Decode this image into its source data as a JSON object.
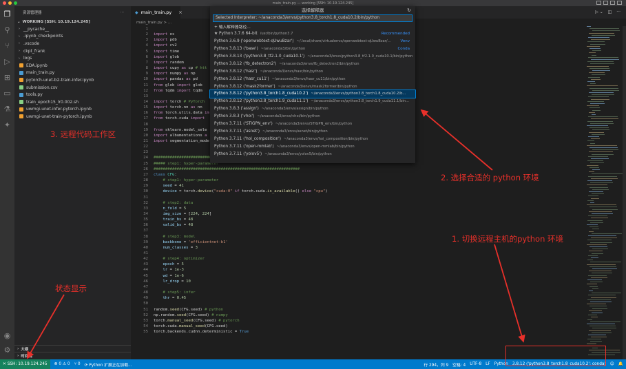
{
  "window": {
    "title": "main_train.py — working [SSH: 10.19.124.245]"
  },
  "explorer": {
    "title": "资源管理器",
    "more": "···",
    "workspace": "WORKING [SSH: 10.19.124.245]",
    "items": [
      {
        "name": "__pycache__",
        "type": "folder",
        "color": ""
      },
      {
        "name": ".ipynb_checkpoints",
        "type": "folder",
        "color": ""
      },
      {
        "name": ".vscode",
        "type": "folder",
        "color": ""
      },
      {
        "name": "ckpt_frank",
        "type": "folder",
        "color": ""
      },
      {
        "name": "logs",
        "type": "folder",
        "color": ""
      },
      {
        "name": "EDA.ipynb",
        "type": "file",
        "color": "#f0a030"
      },
      {
        "name": "main_train.py",
        "type": "file",
        "color": "#4b9cd3"
      },
      {
        "name": "pytorch-unet-b2-train-infer.ipynb",
        "type": "file",
        "color": "#f0a030"
      },
      {
        "name": "submission.csv",
        "type": "file",
        "color": "#89d185"
      },
      {
        "name": "tools.py",
        "type": "file",
        "color": "#4b9cd3"
      },
      {
        "name": "train_epoch15_lr0.002.sh",
        "type": "file",
        "color": "#89d185"
      },
      {
        "name": "uwmgi-unet-infer-pytorch.ipynb",
        "type": "file",
        "color": "#f0a030"
      },
      {
        "name": "uwmgi-unet-train-pytorch.ipynb",
        "type": "file",
        "color": "#f0a030"
      }
    ],
    "outline": "大纲",
    "timeline": "时间线"
  },
  "tab": {
    "label": "main_train.py",
    "close": "×"
  },
  "breadcrumb": "main_train.py > ...",
  "code_lines": [
    [
      {
        "t": "",
        "c": "code"
      }
    ],
    [
      {
        "t": "import",
        "c": "kw"
      },
      {
        "t": " os",
        "c": "code"
      }
    ],
    [
      {
        "t": "import",
        "c": "kw"
      },
      {
        "t": " pdb",
        "c": "code"
      }
    ],
    [
      {
        "t": "import",
        "c": "kw"
      },
      {
        "t": " cv2",
        "c": "code"
      }
    ],
    [
      {
        "t": "import",
        "c": "kw"
      },
      {
        "t": " time",
        "c": "code"
      }
    ],
    [
      {
        "t": "import",
        "c": "kw"
      },
      {
        "t": " glob",
        "c": "code"
      }
    ],
    [
      {
        "t": "import",
        "c": "kw"
      },
      {
        "t": " random",
        "c": "code"
      }
    ],
    [
      {
        "t": "import",
        "c": "kw"
      },
      {
        "t": " cupy ",
        "c": "code"
      },
      {
        "t": "as",
        "c": "kw"
      },
      {
        "t": " cp ",
        "c": "code"
      },
      {
        "t": "# htt",
        "c": "cm"
      }
    ],
    [
      {
        "t": "import",
        "c": "kw"
      },
      {
        "t": " numpy ",
        "c": "code"
      },
      {
        "t": "as",
        "c": "kw"
      },
      {
        "t": " np",
        "c": "code"
      }
    ],
    [
      {
        "t": "import",
        "c": "kw"
      },
      {
        "t": " pandas ",
        "c": "code"
      },
      {
        "t": "as",
        "c": "kw"
      },
      {
        "t": " pd",
        "c": "code"
      }
    ],
    [
      {
        "t": "from",
        "c": "kw"
      },
      {
        "t": " glob ",
        "c": "code"
      },
      {
        "t": "import",
        "c": "kw"
      },
      {
        "t": " glob",
        "c": "code"
      }
    ],
    [
      {
        "t": "from",
        "c": "kw"
      },
      {
        "t": " tqdm ",
        "c": "code"
      },
      {
        "t": "import",
        "c": "kw"
      },
      {
        "t": " tqdm",
        "c": "code"
      }
    ],
    [
      {
        "t": "",
        "c": "code"
      }
    ],
    [
      {
        "t": "import",
        "c": "kw"
      },
      {
        "t": " torch ",
        "c": "code"
      },
      {
        "t": "# PyTorch",
        "c": "cm"
      }
    ],
    [
      {
        "t": "import",
        "c": "kw"
      },
      {
        "t": " torch.nn ",
        "c": "code"
      },
      {
        "t": "as",
        "c": "kw"
      },
      {
        "t": " nn",
        "c": "code"
      }
    ],
    [
      {
        "t": "from",
        "c": "kw"
      },
      {
        "t": " torch.utils.data ",
        "c": "code"
      },
      {
        "t": "im",
        "c": "kw"
      }
    ],
    [
      {
        "t": "from",
        "c": "kw"
      },
      {
        "t": " torch.cuda ",
        "c": "code"
      },
      {
        "t": "import",
        "c": "kw"
      }
    ],
    [
      {
        "t": "",
        "c": "code"
      }
    ],
    [
      {
        "t": "from",
        "c": "kw"
      },
      {
        "t": " sklearn.model_sele",
        "c": "code"
      }
    ],
    [
      {
        "t": "import",
        "c": "kw"
      },
      {
        "t": " albumentations ",
        "c": "code"
      },
      {
        "t": "a",
        "c": "kw"
      }
    ],
    [
      {
        "t": "import",
        "c": "kw"
      },
      {
        "t": " segmentation_mode",
        "c": "code"
      }
    ],
    [
      {
        "t": "",
        "c": "code"
      }
    ],
    [
      {
        "t": "",
        "c": "code"
      }
    ],
    [
      {
        "t": "###############################################################",
        "c": "cm"
      }
    ],
    [
      {
        "t": "##### step1: hyper-parameter",
        "c": "cm"
      }
    ],
    [
      {
        "t": "###############################################################",
        "c": "cm"
      }
    ],
    [
      {
        "t": "class",
        "c": "kwb"
      },
      {
        "t": " ",
        "c": "code"
      },
      {
        "t": "CFG",
        "c": "cls"
      },
      {
        "t": ":",
        "c": "code"
      }
    ],
    [
      {
        "t": "    # step1: hyper-parameter",
        "c": "cm"
      }
    ],
    [
      {
        "t": "    ",
        "c": "code"
      },
      {
        "t": "seed",
        "c": "var"
      },
      {
        "t": " = ",
        "c": "code"
      },
      {
        "t": "41",
        "c": "num"
      }
    ],
    [
      {
        "t": "    ",
        "c": "code"
      },
      {
        "t": "device",
        "c": "var"
      },
      {
        "t": " = torch.",
        "c": "code"
      },
      {
        "t": "device",
        "c": "fn"
      },
      {
        "t": "(",
        "c": "code"
      },
      {
        "t": "\"cuda:0\"",
        "c": "str"
      },
      {
        "t": " ",
        "c": "code"
      },
      {
        "t": "if",
        "c": "kw"
      },
      {
        "t": " torch.cuda.",
        "c": "code"
      },
      {
        "t": "is_available",
        "c": "fn"
      },
      {
        "t": "() ",
        "c": "code"
      },
      {
        "t": "else",
        "c": "kw"
      },
      {
        "t": " ",
        "c": "code"
      },
      {
        "t": "\"cpu\"",
        "c": "str"
      },
      {
        "t": ")",
        "c": "code"
      }
    ],
    [
      {
        "t": "",
        "c": "code"
      }
    ],
    [
      {
        "t": "    # step2: data",
        "c": "cm"
      }
    ],
    [
      {
        "t": "    ",
        "c": "code"
      },
      {
        "t": "n_fold",
        "c": "var"
      },
      {
        "t": " = ",
        "c": "code"
      },
      {
        "t": "5",
        "c": "num"
      }
    ],
    [
      {
        "t": "    ",
        "c": "code"
      },
      {
        "t": "img_size",
        "c": "var"
      },
      {
        "t": " = [",
        "c": "code"
      },
      {
        "t": "224",
        "c": "num"
      },
      {
        "t": ", ",
        "c": "code"
      },
      {
        "t": "224",
        "c": "num"
      },
      {
        "t": "]",
        "c": "code"
      }
    ],
    [
      {
        "t": "    ",
        "c": "code"
      },
      {
        "t": "train_bs",
        "c": "var"
      },
      {
        "t": " = ",
        "c": "code"
      },
      {
        "t": "48",
        "c": "num"
      }
    ],
    [
      {
        "t": "    ",
        "c": "code"
      },
      {
        "t": "valid_bs",
        "c": "var"
      },
      {
        "t": " = ",
        "c": "code"
      },
      {
        "t": "48",
        "c": "num"
      }
    ],
    [
      {
        "t": "",
        "c": "code"
      }
    ],
    [
      {
        "t": "    # step3: model",
        "c": "cm"
      }
    ],
    [
      {
        "t": "    ",
        "c": "code"
      },
      {
        "t": "backbone",
        "c": "var"
      },
      {
        "t": " = ",
        "c": "code"
      },
      {
        "t": "'efficientnet-b1'",
        "c": "str"
      }
    ],
    [
      {
        "t": "    ",
        "c": "code"
      },
      {
        "t": "num_classes",
        "c": "var"
      },
      {
        "t": " = ",
        "c": "code"
      },
      {
        "t": "3",
        "c": "num"
      }
    ],
    [
      {
        "t": "",
        "c": "code"
      }
    ],
    [
      {
        "t": "    # step4: optimizer",
        "c": "cm"
      }
    ],
    [
      {
        "t": "    ",
        "c": "code"
      },
      {
        "t": "epoch",
        "c": "var"
      },
      {
        "t": " = ",
        "c": "code"
      },
      {
        "t": "5",
        "c": "num"
      }
    ],
    [
      {
        "t": "    ",
        "c": "code"
      },
      {
        "t": "lr",
        "c": "var"
      },
      {
        "t": " = ",
        "c": "code"
      },
      {
        "t": "1e-3",
        "c": "num"
      }
    ],
    [
      {
        "t": "    ",
        "c": "code"
      },
      {
        "t": "wd",
        "c": "var"
      },
      {
        "t": " = ",
        "c": "code"
      },
      {
        "t": "1e-6",
        "c": "num"
      }
    ],
    [
      {
        "t": "    ",
        "c": "code"
      },
      {
        "t": "lr_drop",
        "c": "var"
      },
      {
        "t": " = ",
        "c": "code"
      },
      {
        "t": "10",
        "c": "num"
      }
    ],
    [
      {
        "t": "",
        "c": "code"
      }
    ],
    [
      {
        "t": "    # step5: infer",
        "c": "cm"
      }
    ],
    [
      {
        "t": "    ",
        "c": "code"
      },
      {
        "t": "thr",
        "c": "var"
      },
      {
        "t": " = ",
        "c": "code"
      },
      {
        "t": "0.45",
        "c": "num"
      }
    ],
    [
      {
        "t": "",
        "c": "code"
      }
    ],
    [
      {
        "t": "random.",
        "c": "code"
      },
      {
        "t": "seed",
        "c": "fn"
      },
      {
        "t": "(CFG.seed) ",
        "c": "code"
      },
      {
        "t": "# python",
        "c": "cm"
      }
    ],
    [
      {
        "t": "np.random.",
        "c": "code"
      },
      {
        "t": "seed",
        "c": "fn"
      },
      {
        "t": "(CFG.seed) ",
        "c": "code"
      },
      {
        "t": "# numpy",
        "c": "cm"
      }
    ],
    [
      {
        "t": "torch.",
        "c": "code"
      },
      {
        "t": "manual_seed",
        "c": "fn"
      },
      {
        "t": "(CFG.seed) ",
        "c": "code"
      },
      {
        "t": "# pytorch",
        "c": "cm"
      }
    ],
    [
      {
        "t": "torch.cuda.",
        "c": "code"
      },
      {
        "t": "manual_seed",
        "c": "fn"
      },
      {
        "t": "(CFG.seed)",
        "c": "code"
      }
    ],
    [
      {
        "t": "torch.backends.cudnn.deterministic = ",
        "c": "code"
      },
      {
        "t": "True",
        "c": "kwb"
      }
    ]
  ],
  "interpreter_picker": {
    "title": "选择解释器",
    "refresh": "↻",
    "input_value": "Selected Interpreter: ~/anaconda3/envs/python3.8_torch1.8_cuda10.2/bin/python",
    "items": [
      {
        "label": "+ 输入解释器路径...",
        "desc": "",
        "tag": "",
        "selected": false
      },
      {
        "label": "★ Python 3.7.6 64-bit",
        "desc": "/usr/bin/python3.7",
        "tag": "Recommended",
        "selected": false
      },
      {
        "label": "Python 3.6.9 ('openwebtext-qUwuBzar')",
        "desc": "~/.local/share/virtualenvs/openwebtext-qUwuBzar/...",
        "tag": "Venv",
        "selected": false
      },
      {
        "label": "Python 3.8.13 ('base')",
        "desc": "~/anaconda3/bin/python",
        "tag": "Conda",
        "selected": false
      },
      {
        "label": "Python 3.8.13 ('python3.8_tf2.1.0_cuda10.1')",
        "desc": "~/anaconda3/envs/python3.8_tf2.1.0_cuda10.1/bin/python",
        "tag": "",
        "selected": false
      },
      {
        "label": "Python 3.8.12 ('fb_detectron2')",
        "desc": "~/anaconda3/envs/fb_detectron2/bin/python",
        "tag": "",
        "selected": false
      },
      {
        "label": "Python 3.8.12 ('hasr')",
        "desc": "~/anaconda3/envs/hasr/bin/python",
        "tag": "",
        "selected": false
      },
      {
        "label": "Python 3.8.12 ('hasr_cu11')",
        "desc": "~/anaconda3/envs/hasr_cu11/bin/python",
        "tag": "",
        "selected": false
      },
      {
        "label": "Python 3.8.12 ('mask2former')",
        "desc": "~/anaconda3/envs/mask2former/bin/python",
        "tag": "",
        "selected": false
      },
      {
        "label": "Python 3.8.12 ('python3.8_torch1.8_cuda10.2')",
        "desc": "~/anaconda3/envs/python3.8_torch1.8_cuda10.2/b...",
        "tag": "",
        "selected": true
      },
      {
        "label": "Python 3.8.12 ('python3.8_torch1.9_cuda11.1')",
        "desc": "~/anaconda3/envs/python3.8_torch1.9_cuda11.1/bin...",
        "tag": "",
        "selected": false
      },
      {
        "label": "Python 3.8.3 ('assign')",
        "desc": "~/anaconda3/envs/assign/bin/python",
        "tag": "",
        "selected": false
      },
      {
        "label": "Python 3.8.3 ('vhoi')",
        "desc": "~/anaconda3/envs/vhoi/bin/python",
        "tag": "",
        "selected": false
      },
      {
        "label": "Python 3.7.11 ('STIGPN_env')",
        "desc": "~/anaconda3/envs/STIGPN_env/bin/python",
        "tag": "",
        "selected": false
      },
      {
        "label": "Python 3.7.11 ('asnet')",
        "desc": "~/anaconda3/envs/asnet/bin/python",
        "tag": "",
        "selected": false
      },
      {
        "label": "Python 3.7.11 ('hoi_composition')",
        "desc": "~/anaconda3/envs/hoi_composition/bin/python",
        "tag": "",
        "selected": false
      },
      {
        "label": "Python 3.7.11 ('open-mmlab')",
        "desc": "~/anaconda3/envs/open-mmlab/bin/python",
        "tag": "",
        "selected": false
      },
      {
        "label": "Python 3.7.11 ('yolov5')",
        "desc": "~/anaconda3/envs/yolov5/bin/python",
        "tag": "",
        "selected": false
      }
    ]
  },
  "statusbar": {
    "remote": "✕ SSH: 10.19.124.245",
    "problems": "⊗ 0 ⚠ 0",
    "ports": "⑂ 0",
    "ext": "⟳ Python 扩展正在加载...",
    "position": "行 294，列 9",
    "spaces": "空格: 4",
    "encoding": "UTF-8",
    "eol": "LF",
    "language": "Python",
    "interpreter": "3.8.12 ('python3.8_torch1.8_cuda10.2': conda)",
    "feedback": "☺",
    "bell": "🔔"
  },
  "annotations": {
    "workspace": "3. 远程代码工作区",
    "choose_env": "2. 选择合适的 python 环境",
    "switch": "1. 切换远程主机的python 环境",
    "status": "状态显示"
  },
  "colors": {
    "accent": "#007acc",
    "remote": "#16825d",
    "annotation": "#e8302a"
  }
}
